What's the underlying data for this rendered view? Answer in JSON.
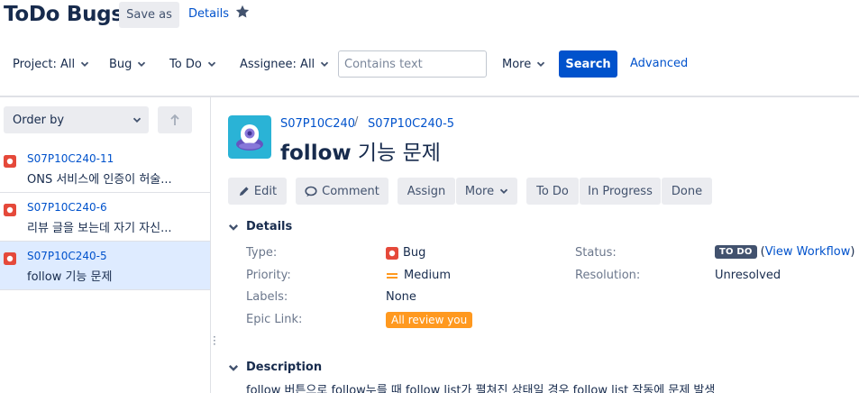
{
  "header": {
    "title": "ToDo Bugs",
    "save_as_label": "Save as",
    "details_label": "Details",
    "star_icon": "star-icon"
  },
  "filters": {
    "project": "Project: All",
    "type": "Bug",
    "status": "To Do",
    "assignee": "Assignee: All",
    "search_placeholder": "Contains text",
    "search_value": "",
    "more_label": "More",
    "search_button": "Search",
    "advanced_label": "Advanced"
  },
  "left_panel": {
    "order_by_label": "Order by",
    "sort_icon": "arrow-up-icon",
    "issues": [
      {
        "key": "S07P10C240-11",
        "summary": "ONS 서비스에 인증이 허술...",
        "selected": false
      },
      {
        "key": "S07P10C240-6",
        "summary": "리뷰 글을 보는데 자기 자신...",
        "selected": false
      },
      {
        "key": "S07P10C240-5",
        "summary": "follow 기능 문제",
        "selected": true
      }
    ]
  },
  "issue_view": {
    "project_key": "S07P10C240",
    "breadcrumb_sep": "/",
    "issue_key": "S07P10C240-5",
    "title_main": "follow",
    "title_rest": " 기능 문제",
    "actions": {
      "edit": "Edit",
      "comment": "Comment",
      "assign": "Assign",
      "more": "More",
      "todo": "To Do",
      "in_progress": "In Progress",
      "done": "Done"
    },
    "details_heading": "Details",
    "fields": {
      "type_label": "Type:",
      "type_value": "Bug",
      "priority_label": "Priority:",
      "priority_value": "Medium",
      "labels_label": "Labels:",
      "labels_value": "None",
      "epic_label": "Epic Link:",
      "epic_value": "All review you",
      "status_label": "Status:",
      "status_value": "TO DO",
      "workflow_open": "(",
      "workflow_link": "View Workflow",
      "workflow_close": ")",
      "resolution_label": "Resolution:",
      "resolution_value": "Unresolved"
    },
    "description_heading": "Description",
    "description_text": "follow 버튼으로 follow누를 때 follow list가 펼쳐진 상태일 경우 follow list 작동에 문제 발생"
  },
  "colors": {
    "accent": "#0052cc",
    "bug": "#e5493a",
    "priority_medium": "#ff991f",
    "epic": "#ff991f",
    "status_todo": "#42526e",
    "selected_row": "#deebff"
  }
}
